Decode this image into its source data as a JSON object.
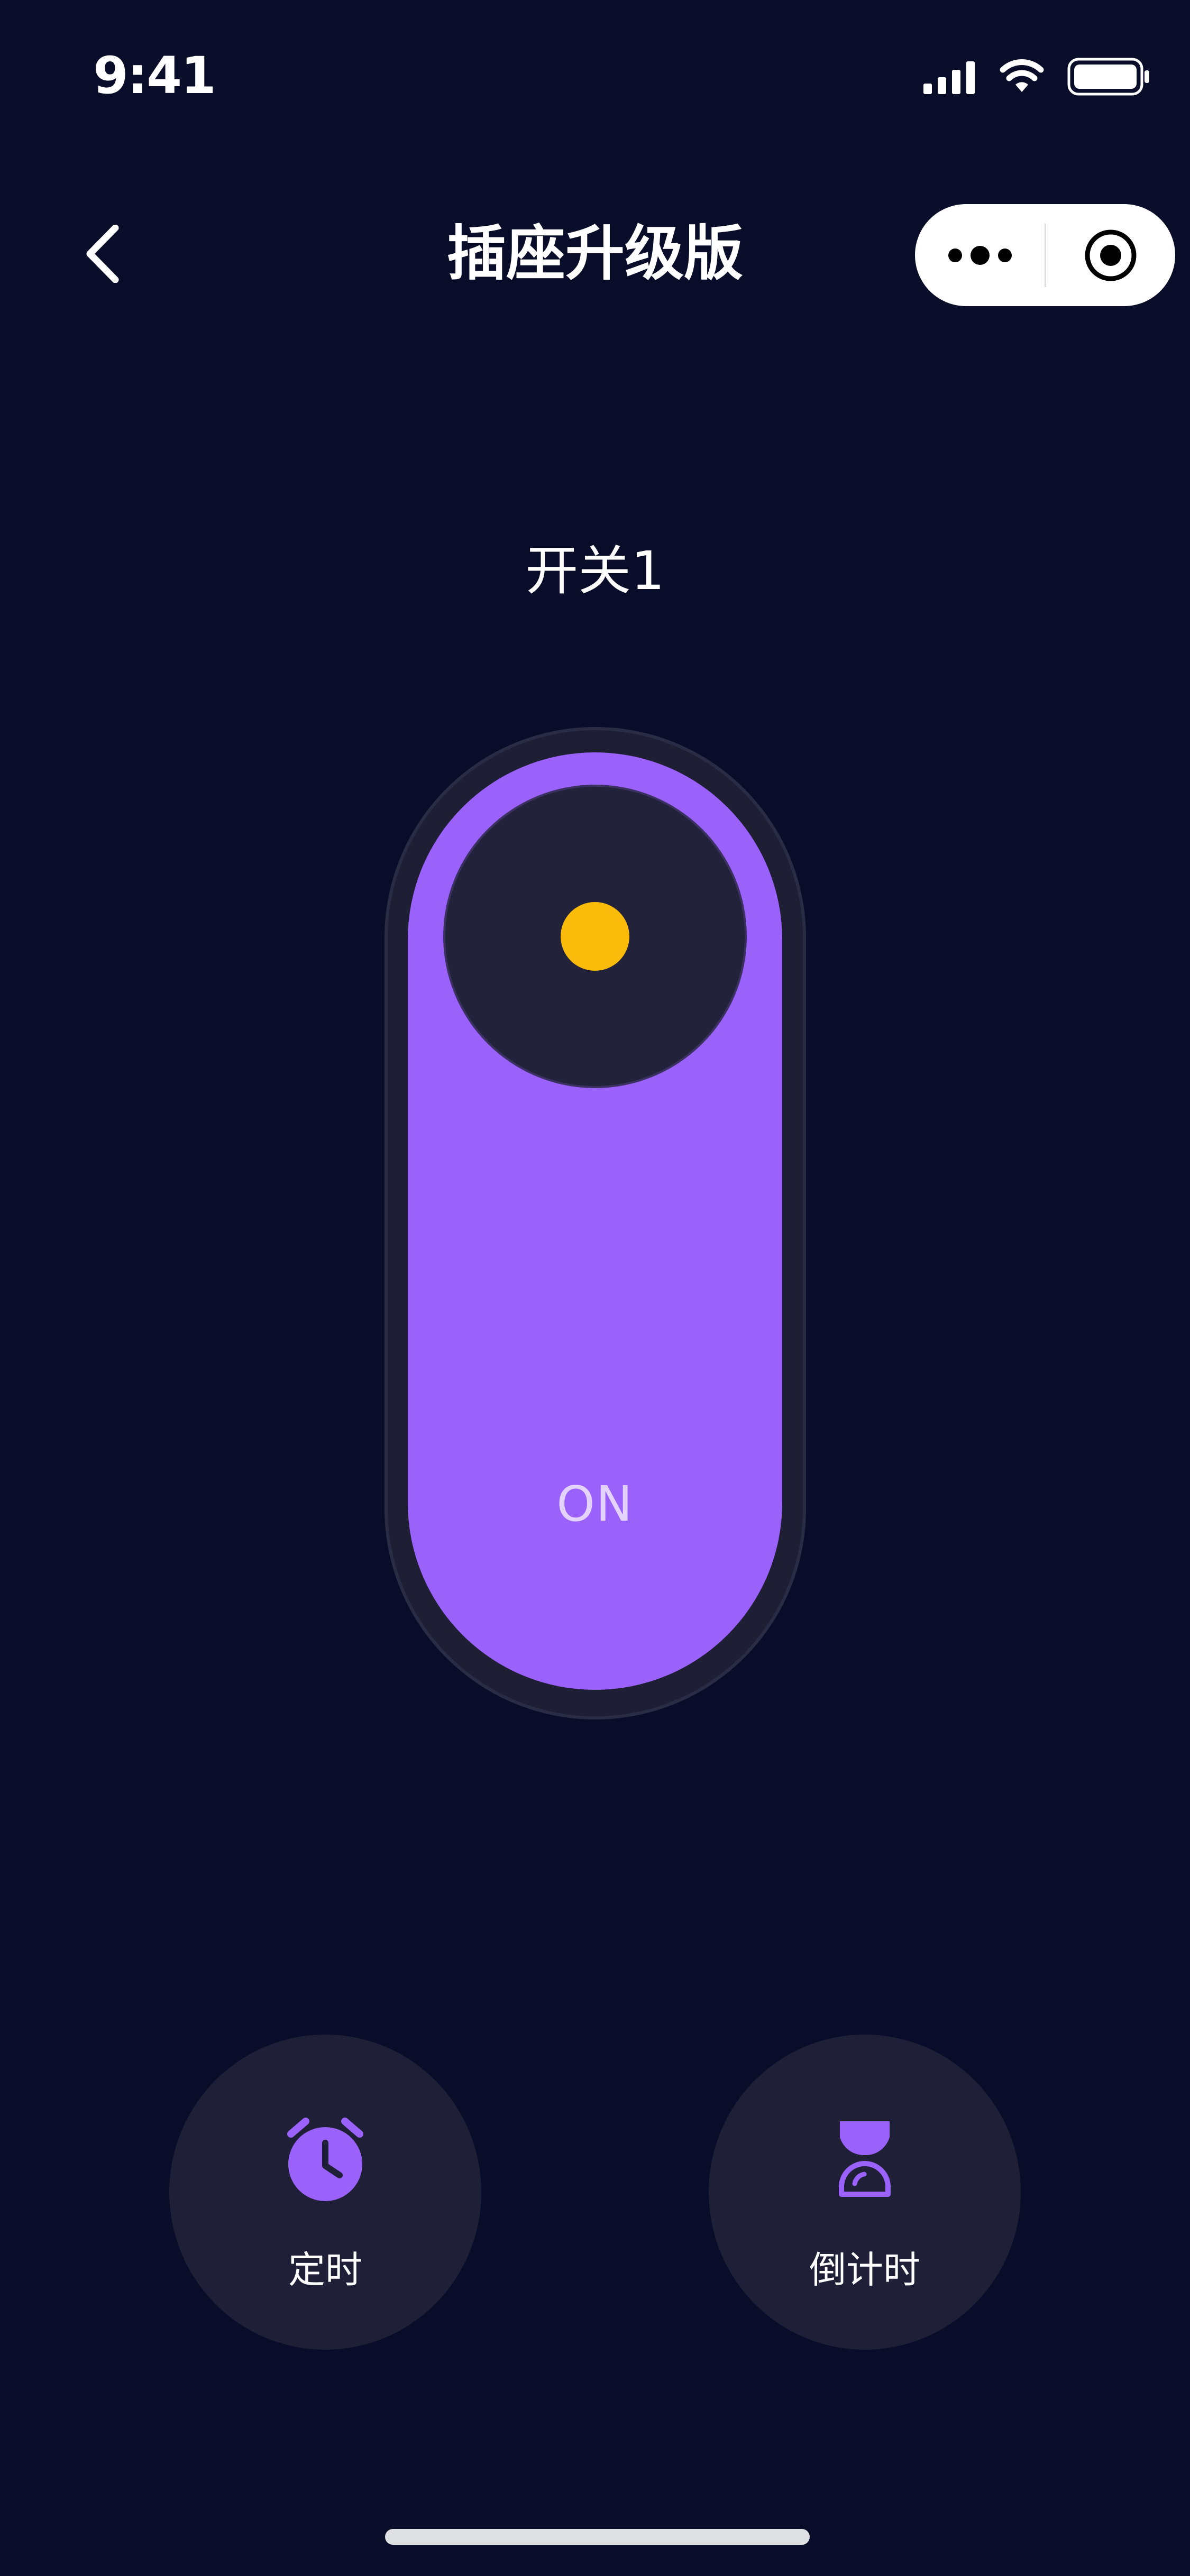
{
  "status_bar": {
    "time": "9:41",
    "icons": [
      "signal-icon",
      "wifi-icon",
      "battery-icon"
    ]
  },
  "nav": {
    "title": "插座升级版",
    "back_icon": "chevron-left-icon",
    "menu_icon": "more-dots-icon",
    "close_icon": "target-circle-icon"
  },
  "switch": {
    "label": "开关1",
    "state": "ON",
    "is_on": true,
    "colors": {
      "track": "#9b62fb",
      "knob": "#22223a",
      "indicator": "#fbbb0a",
      "background": "#0a0d29"
    }
  },
  "actions": [
    {
      "label": "定时",
      "icon": "alarm-clock-icon"
    },
    {
      "label": "倒计时",
      "icon": "hourglass-icon"
    }
  ]
}
